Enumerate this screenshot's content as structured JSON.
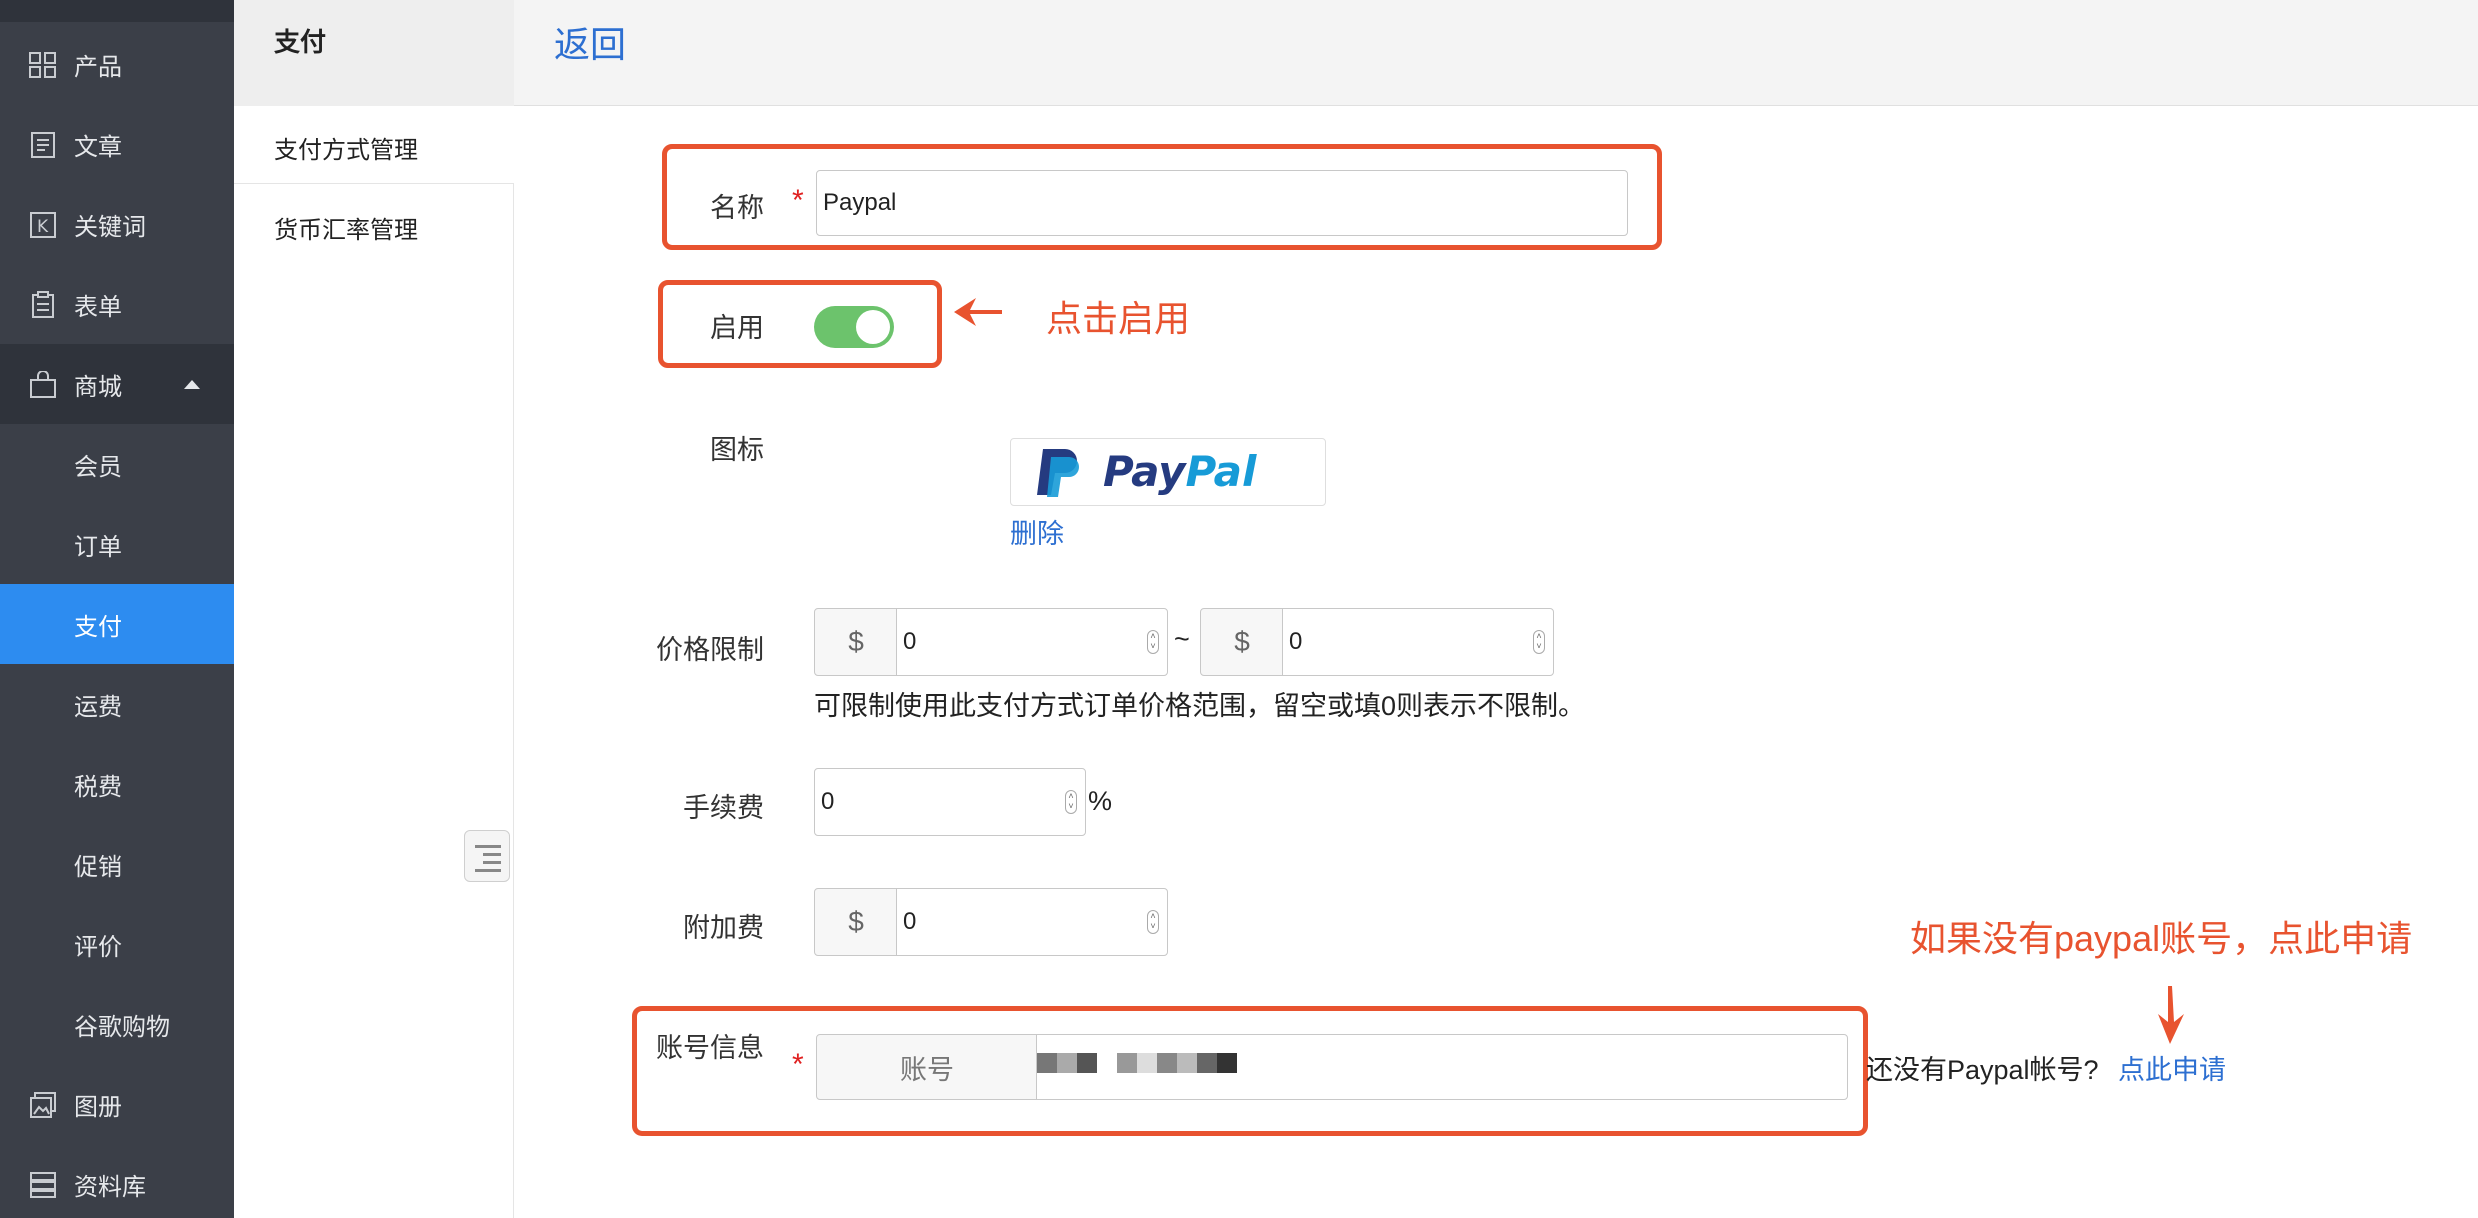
{
  "sidebar": {
    "items": [
      {
        "label": "产品",
        "icon": "grid-icon"
      },
      {
        "label": "文章",
        "icon": "document-icon"
      },
      {
        "label": "关键词",
        "icon": "keyword-icon"
      },
      {
        "label": "表单",
        "icon": "clipboard-icon"
      },
      {
        "label": "商城",
        "icon": "shopping-bag-icon"
      },
      {
        "label": "会员"
      },
      {
        "label": "订单"
      },
      {
        "label": "支付"
      },
      {
        "label": "运费"
      },
      {
        "label": "税费"
      },
      {
        "label": "促销"
      },
      {
        "label": "评价"
      },
      {
        "label": "谷歌购物"
      },
      {
        "label": "图册",
        "icon": "gallery-icon"
      },
      {
        "label": "资料库",
        "icon": "database-icon"
      }
    ],
    "active": "支付",
    "colors": {
      "bg": "#3b3f48",
      "active": "#2d8cf0"
    }
  },
  "subnav": {
    "title": "支付",
    "items": [
      "支付方式管理",
      "货币汇率管理"
    ]
  },
  "header": {
    "back_label": "返回"
  },
  "form": {
    "name_label": "名称",
    "name_value": "Paypal",
    "enable_label": "启用",
    "enable_on": true,
    "icon_label": "图标",
    "icon_logo_text_a": "Pay",
    "icon_logo_text_b": "Pal",
    "delete_label": "删除",
    "price_label": "价格限制",
    "currency_symbol": "$",
    "price_min": "0",
    "price_sep": "~",
    "price_max": "0",
    "price_hint": "可限制使用此支付方式订单价格范围，留空或填0则表示不限制。",
    "fee_label": "手续费",
    "fee_value": "0",
    "fee_unit": "%",
    "surcharge_label": "附加费",
    "surcharge_value": "0",
    "account_label": "账号信息",
    "account_addon": "账号",
    "no_account_text": "还没有Paypal帐号?",
    "apply_link": "点此申请",
    "required_mark": "*"
  },
  "annotations": {
    "enable_hint": "点击启用",
    "apply_hint": "如果没有paypal账号，点此申请",
    "color": "#e8532f"
  }
}
